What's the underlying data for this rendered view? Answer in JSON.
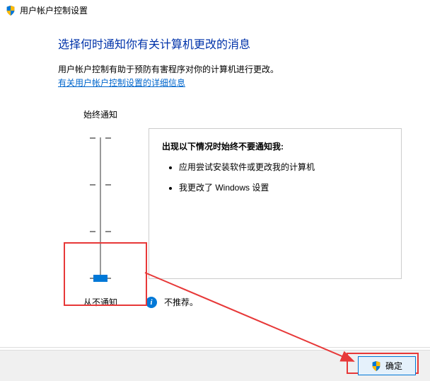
{
  "titlebar": {
    "title": "用户帐户控制设置"
  },
  "heading": "选择何时通知你有关计算机更改的消息",
  "description": "用户帐户控制有助于预防有害程序对你的计算机进行更改。",
  "link_text": "有关用户帐户控制设置的详细信息",
  "slider": {
    "top_label": "始终通知",
    "bottom_label": "从不通知"
  },
  "info_box": {
    "title": "出现以下情况时始终不要通知我:",
    "items": [
      "应用尝试安装软件或更改我的计算机",
      "我更改了 Windows 设置"
    ]
  },
  "recommendation": "不推荐。",
  "buttons": {
    "ok": "确定"
  }
}
